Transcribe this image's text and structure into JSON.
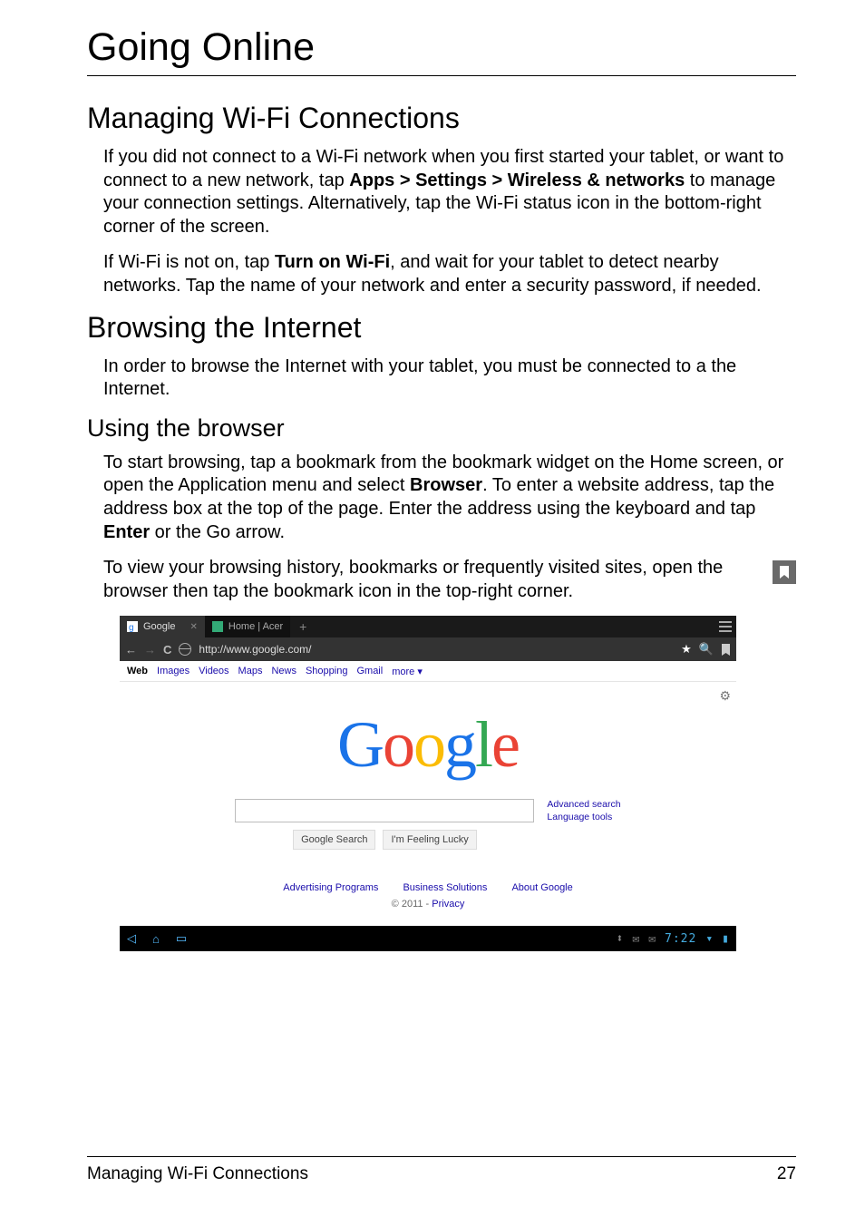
{
  "page": {
    "title": "Going Online",
    "section1": {
      "heading": "Managing Wi-Fi Connections",
      "p1_pre": "If you did not connect to a Wi-Fi network when you first started your tablet, or want to connect to a new network, tap ",
      "p1_bold": "Apps > Settings > Wireless & networks",
      "p1_post": " to manage your connection settings. Alternatively, tap the Wi-Fi status icon in the bottom-right corner of the screen.",
      "p2_pre": "If Wi-Fi is not on, tap ",
      "p2_bold": "Turn on Wi-Fi",
      "p2_post": ", and wait for your tablet to detect nearby networks. Tap the name of your network and enter a security password, if needed."
    },
    "section2": {
      "heading": "Browsing the Internet",
      "p1": "In order to browse the Internet with your tablet, you must be connected to a the Internet."
    },
    "section3": {
      "heading": "Using the browser",
      "p1_a": "To start browsing, tap a bookmark from the bookmark widget on the Home screen, or open the Application menu and select ",
      "p1_b": "Browser",
      "p1_c": ". To enter a website address, tap the address box at the top of the page. Enter the address using the keyboard and tap ",
      "p1_d": "Enter",
      "p1_e": " or the Go arrow.",
      "p2": "To view your browsing history, bookmarks or frequently visited sites, open the browser then tap the bookmark icon in the top-right corner."
    }
  },
  "screenshot": {
    "tabs": {
      "active": "Google",
      "inactive": "Home | Acer"
    },
    "url": "http://www.google.com/",
    "google": {
      "nav": {
        "web": "Web",
        "images": "Images",
        "videos": "Videos",
        "maps": "Maps",
        "news": "News",
        "shopping": "Shopping",
        "gmail": "Gmail",
        "more": "more ▾"
      },
      "logo": "Google",
      "logo_colors": [
        "#1a73e8",
        "#ea4335",
        "#fbbc05",
        "#1a73e8",
        "#34a853",
        "#ea4335"
      ],
      "btn_search": "Google Search",
      "btn_lucky": "I'm Feeling Lucky",
      "side1": "Advanced search",
      "side2": "Language tools",
      "footer": {
        "adv": "Advertising Programs",
        "biz": "Business Solutions",
        "about": "About Google",
        "copy": "© 2011 - ",
        "priv": "Privacy"
      }
    },
    "clock": "7:22"
  },
  "footer": {
    "left": "Managing Wi-Fi Connections",
    "right": "27"
  }
}
